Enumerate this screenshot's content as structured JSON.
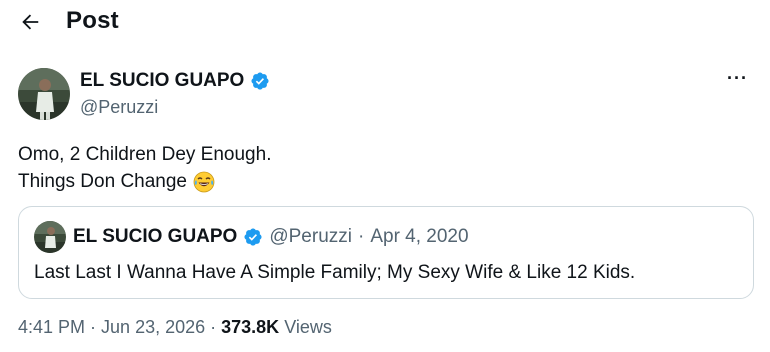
{
  "header": {
    "title": "Post",
    "back_icon": "arrow-left-icon"
  },
  "post": {
    "author": {
      "display_name": "EL SUCIO GUAPO",
      "handle": "@Peruzzi",
      "verified": true,
      "verified_color": "#1d9bf0"
    },
    "more_icon": "more-horizontal-icon",
    "more_label": "···",
    "text_lines": [
      "Omo, 2 Children Dey Enough.",
      "Things Don Change"
    ],
    "emoji_icon": "tears-of-joy-emoji-icon",
    "quote": {
      "display_name": "EL SUCIO GUAPO",
      "handle": "@Peruzzi",
      "separator": "·",
      "date": "Apr 4, 2020",
      "text": "Last Last I Wanna Have A Simple Family; My Sexy Wife & Like 12 Kids."
    },
    "meta": {
      "time": "4:41 PM",
      "separator": "·",
      "date": "Jun 23, 2026",
      "views_count": "373.8K",
      "views_label": "Views"
    }
  }
}
